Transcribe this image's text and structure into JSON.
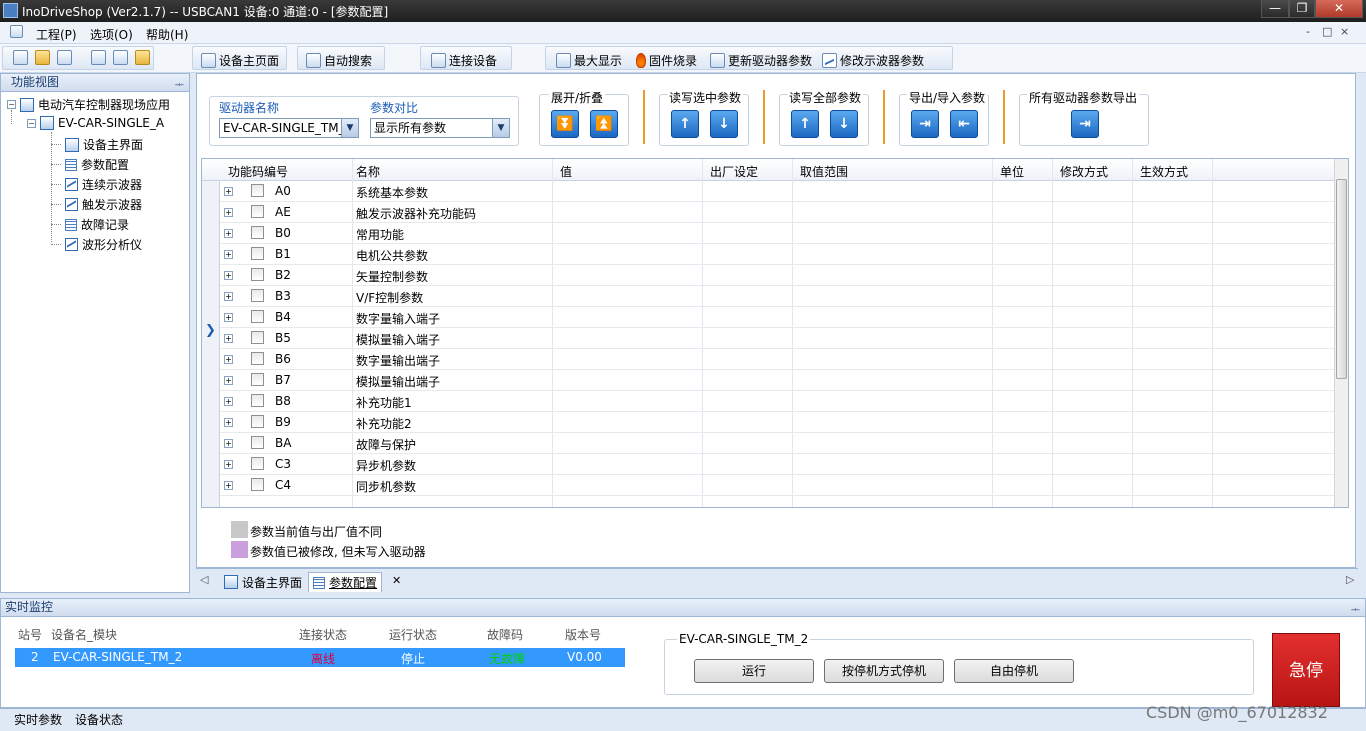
{
  "window": {
    "title": "InoDriveShop (Ver2.1.7) -- USBCAN1 设备:0 通道:0 - [参数配置]",
    "minimize": "—",
    "maximize": "❐",
    "close": "✕"
  },
  "menu": {
    "items": [
      "工程(P)",
      "选项(O)",
      "帮助(H)"
    ],
    "mdi_controls": [
      "-",
      "□",
      "×"
    ]
  },
  "toolbar": {
    "device_home": "设备主页面",
    "auto_search": "自动搜索",
    "connect_device": "连接设备",
    "maximize_display": "最大显示",
    "firmware_burn": "固件烧录",
    "update_driver_params": "更新驱动器参数",
    "modify_scope_params": "修改示波器参数"
  },
  "left_panel": {
    "title": "功能视图",
    "pin": "ᆠ",
    "tree": {
      "root": "电动汽车控制器现场应用",
      "device": "EV-CAR-SINGLE_A",
      "items": [
        {
          "label": "设备主界面",
          "icon": "device-icon"
        },
        {
          "label": "参数配置",
          "icon": "grid-icon"
        },
        {
          "label": "连续示波器",
          "icon": "wave-icon"
        },
        {
          "label": "触发示波器",
          "icon": "wave-icon"
        },
        {
          "label": "故障记录",
          "icon": "grid-icon"
        },
        {
          "label": "波形分析仪",
          "icon": "wave-icon"
        }
      ]
    }
  },
  "param_panel": {
    "driver_name_label": "驱动器名称",
    "driver_name_value": "EV-CAR-SINGLE_TM_2",
    "param_compare_label": "参数对比",
    "param_compare_value": "显示所有参数",
    "expand_collapse_label": "展开/折叠",
    "rw_selected_label": "读写选中参数",
    "rw_all_label": "读写全部参数",
    "export_import_label": "导出/导入参数",
    "export_all_label": "所有驱动器参数导出",
    "columns": [
      "功能码编号",
      "名称",
      "值",
      "出厂设定",
      "取值范围",
      "单位",
      "修改方式",
      "生效方式"
    ],
    "rows": [
      {
        "code": "A0",
        "name": "系统基本参数"
      },
      {
        "code": "AE",
        "name": "触发示波器补充功能码"
      },
      {
        "code": "B0",
        "name": "常用功能"
      },
      {
        "code": "B1",
        "name": "电机公共参数"
      },
      {
        "code": "B2",
        "name": "矢量控制参数"
      },
      {
        "code": "B3",
        "name": "V/F控制参数"
      },
      {
        "code": "B4",
        "name": "数字量输入端子"
      },
      {
        "code": "B5",
        "name": "模拟量输入端子"
      },
      {
        "code": "B6",
        "name": "数字量输出端子"
      },
      {
        "code": "B7",
        "name": "模拟量输出端子"
      },
      {
        "code": "B8",
        "name": "补充功能1"
      },
      {
        "code": "B9",
        "name": "补充功能2"
      },
      {
        "code": "BA",
        "name": "故障与保护"
      },
      {
        "code": "C3",
        "name": "异步机参数"
      },
      {
        "code": "C4",
        "name": "同步机参数"
      }
    ],
    "legend": [
      {
        "text": "参数当前值与出厂值不同",
        "color": "#c8c8c8"
      },
      {
        "text": "参数值已被修改, 但未写入驱动器",
        "color": "#c9a0dc"
      }
    ]
  },
  "doc_tabs": [
    {
      "label": "设备主界面"
    },
    {
      "label": "参数配置",
      "close": "✕"
    }
  ],
  "monitor": {
    "title": "实时监控",
    "columns": [
      "站号",
      "设备名_模块",
      "连接状态",
      "运行状态",
      "故障码",
      "版本号"
    ],
    "row": {
      "station": "2",
      "device": "EV-CAR-SINGLE_TM_2",
      "connection": "离线",
      "run_state": "停止",
      "fault": "无故障",
      "version": "V0.00"
    },
    "control_group_title": "EV-CAR-SINGLE_TM_2",
    "run_button": "运行",
    "stop_mode_button": "按停机方式停机",
    "free_stop_button": "自由停机",
    "estop_button": "急停",
    "colors": {
      "offline": "#e0003c",
      "no_fault": "#00d100",
      "selection": "#3399ff",
      "estop": "#cc1e1e"
    }
  },
  "bottom_tabs": [
    "实时参数",
    "设备状态"
  ],
  "watermark": "CSDN @m0_67012832"
}
